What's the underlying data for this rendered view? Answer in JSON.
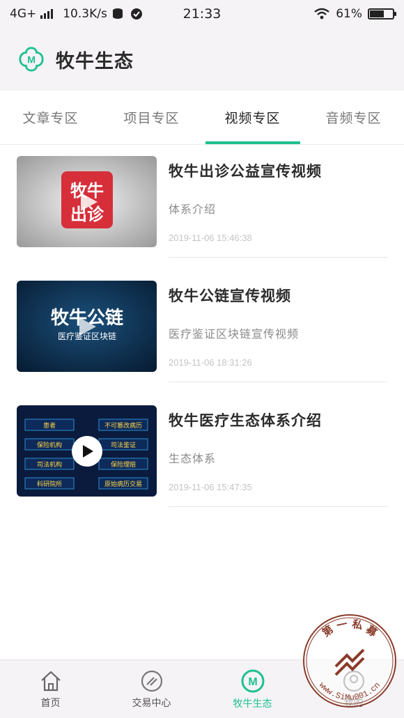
{
  "status_bar": {
    "network": "4G+",
    "speed": "10.3K/s",
    "time": "21:33",
    "battery": "61%",
    "battery_level": 0.61
  },
  "header": {
    "logo_icon": "cow-logo-icon",
    "title": "牧牛生态"
  },
  "tabs": [
    {
      "label": "文章专区",
      "active": false
    },
    {
      "label": "项目专区",
      "active": false
    },
    {
      "label": "视频专区",
      "active": true
    },
    {
      "label": "音频专区",
      "active": false
    }
  ],
  "videos": [
    {
      "title": "牧牛出诊公益宣传视频",
      "desc": "体系介绍",
      "time": "2019-11-06 15:46:38",
      "thumb_text_line1": "牧牛",
      "thumb_text_line2": "出诊"
    },
    {
      "title": "牧牛公链宣传视频",
      "desc": "医疗鉴证区块链宣传视频",
      "time": "2019-11-06 18:31:26",
      "thumb_text_line1": "牧牛公链",
      "thumb_text_line2": "医疗鉴证区块链"
    },
    {
      "title": "牧牛医疗生态体系介绍",
      "desc": "生态体系",
      "time": "2019-11-06 15:47:35",
      "thumb_labels": [
        "患者",
        "不可篡改病历",
        "保险机构",
        "司法鉴证",
        "司法机构",
        "保险理赔",
        "科研院所",
        "原始病历交易"
      ]
    }
  ],
  "bottom_nav": [
    {
      "label": "首页",
      "icon": "home-icon",
      "active": false
    },
    {
      "label": "交易中心",
      "icon": "trade-icon",
      "active": false
    },
    {
      "label": "牧牛生态",
      "icon": "cow-logo-icon",
      "active": true
    },
    {
      "label": "我的",
      "icon": "profile-icon",
      "active": false
    }
  ],
  "watermark": {
    "text_top": "第 一 私 募",
    "text_bottom": "www.SiMu001.cn"
  },
  "colors": {
    "accent": "#1ec090",
    "background": "#f5f3f6",
    "title": "#2b2b2b",
    "muted": "#8a8a8a"
  }
}
